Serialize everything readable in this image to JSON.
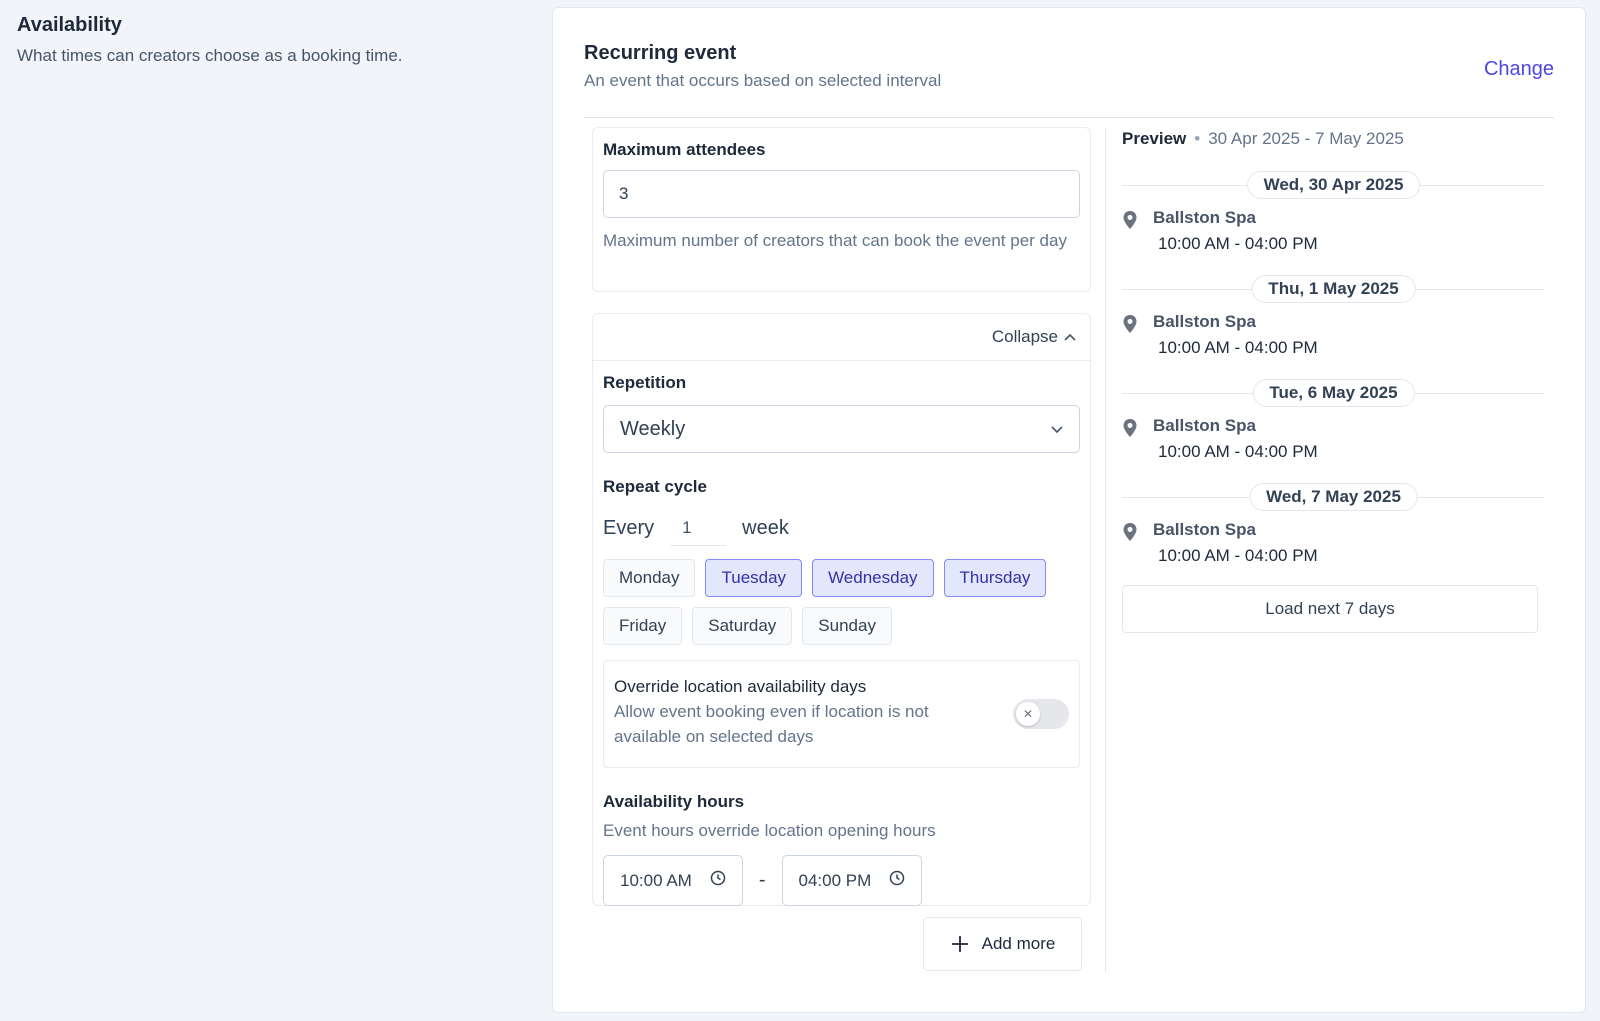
{
  "section": {
    "title": "Availability",
    "description": "What times can creators choose as a booking time."
  },
  "event_type": {
    "title": "Recurring event",
    "description": "An event that occurs based on selected interval",
    "change_label": "Change"
  },
  "attendees": {
    "label": "Maximum attendees",
    "value": "3",
    "help": "Maximum number of creators that can book the event per day"
  },
  "repetition": {
    "collapse_label": "Collapse",
    "label": "Repetition",
    "selected": "Weekly",
    "repeat_cycle_label": "Repeat cycle",
    "every_label": "Every",
    "every_value": "1",
    "unit_label": "week",
    "days": [
      {
        "label": "Monday",
        "selected": false
      },
      {
        "label": "Tuesday",
        "selected": true
      },
      {
        "label": "Wednesday",
        "selected": true
      },
      {
        "label": "Thursday",
        "selected": true
      },
      {
        "label": "Friday",
        "selected": false
      },
      {
        "label": "Saturday",
        "selected": false
      },
      {
        "label": "Sunday",
        "selected": false
      }
    ],
    "override": {
      "title": "Override location availability days",
      "description": "Allow event booking even if location is not available on selected days",
      "enabled": false,
      "toggle_icon": "x-icon"
    },
    "hours": {
      "label": "Availability hours",
      "description": "Event hours override location opening hours",
      "start": "10:00 AM",
      "separator": "-",
      "end": "04:00 PM"
    }
  },
  "add_more_label": "Add more",
  "preview": {
    "label": "Preview",
    "range": "30 Apr 2025 - 7 May 2025",
    "days": [
      {
        "date": "Wed, 30 Apr 2025",
        "location": "Ballston Spa",
        "time": "10:00 AM - 04:00 PM"
      },
      {
        "date": "Thu, 1 May 2025",
        "location": "Ballston Spa",
        "time": "10:00 AM - 04:00 PM"
      },
      {
        "date": "Tue, 6 May 2025",
        "location": "Ballston Spa",
        "time": "10:00 AM - 04:00 PM"
      },
      {
        "date": "Wed, 7 May 2025",
        "location": "Ballston Spa",
        "time": "10:00 AM - 04:00 PM"
      }
    ],
    "load_next_label": "Load next 7 days"
  },
  "colors": {
    "accent": "#4f46e5",
    "selected_day_bg": "#e3e7fc",
    "selected_day_border": "#818cf8",
    "page_bg": "#f1f4f9"
  }
}
